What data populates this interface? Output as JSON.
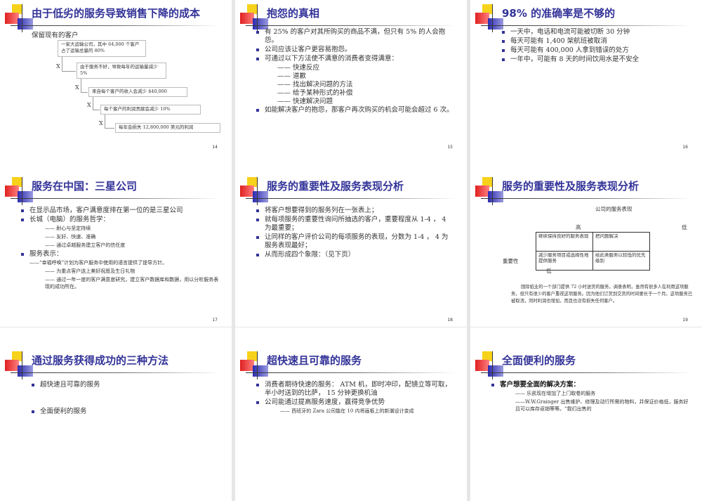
{
  "slides": [
    {
      "number": "14",
      "title": "由于低劣的服务导致销售下降的成本",
      "diagram": {
        "subtitle": "保留现有的客户",
        "mult": "X",
        "boxes": [
          "一家大运输公司，其中 64,000 个客户占了运输总量的 80%",
          "由于服务不好，导致每年的运输量减少 5%",
          "来自每个客户的收入会减少 $40,000",
          "每个客户的利润贡献会减少 10%",
          "每年会损失 12,800,000 美元的利润"
        ]
      }
    },
    {
      "number": "15",
      "title": "抱怨的真相",
      "items": [
        {
          "t": "b",
          "text": "有 25% 的客户对其所购买的商品不满，但只有 5% 的人会抱怨。"
        },
        {
          "t": "b",
          "text": "公司应该让客户更容易抱怨。"
        },
        {
          "t": "b",
          "text": "可通过以下方法使不满意的消费者变得满意："
        },
        {
          "t": "s",
          "text": "——  快速反应"
        },
        {
          "t": "s",
          "text": "——  道歉"
        },
        {
          "t": "s",
          "text": "——  找出解决问题的方法"
        },
        {
          "t": "s",
          "text": "——  给予某种形式的补偿"
        },
        {
          "t": "s",
          "text": "——  快速解决问题"
        },
        {
          "t": "b",
          "text": "如能解决客户的抱怨，那客户再次购买的机会可能会超过 6 次。"
        }
      ]
    },
    {
      "number": "16",
      "title": "98% 的准确率是不够的",
      "items": [
        {
          "t": "b",
          "text": "一天中，电话和电流可能被切断 30 分钟"
        },
        {
          "t": "b",
          "text": "每天可能有 1,400 架航班被取消"
        },
        {
          "t": "b",
          "text": "每天可能有 400,000 人拿到错误的处方"
        },
        {
          "t": "b",
          "text": "一年中，可能有 8 天的时间饮用水是不安全"
        }
      ]
    },
    {
      "number": "17",
      "title": "服务在中国：三星公司",
      "items": [
        {
          "t": "b",
          "text": "在显示品市场，客户满意度排在第一位的是三星公司"
        },
        {
          "t": "b",
          "text": "长城（电脑）的服务哲学："
        },
        {
          "t": "s2",
          "text": "—— 耐心与坚定持续"
        },
        {
          "t": "s2",
          "text": "—— 友好、快速、准确"
        },
        {
          "t": "s2",
          "text": "—— 通过卓越服务建立客户的信任度"
        },
        {
          "t": "b",
          "text": "服务表示："
        },
        {
          "t": "s3",
          "text": "——“幸福呼唤”计划为客户服务中使用的语言提供了提导方针。"
        },
        {
          "t": "s2",
          "text": "—— 为重点客户送上美好祝愿及生日礼物"
        },
        {
          "t": "s2",
          "text": "—— 通过一年一度的客户满意度研究，建立客户数据库和数据，用以分析服务表现的成功所在。"
        }
      ]
    },
    {
      "number": "18",
      "title": "服务的重要性及服务表现分析",
      "items": [
        {
          "t": "b",
          "text": "将客户想要得到的服务列在一张表上；"
        },
        {
          "t": "b",
          "text": "就每项服务的重要性询问所抽选的客户，重要程度从 1-4 ， 4 为最重要；"
        },
        {
          "t": "b",
          "text": "让同样的客户评价公司的每项服务的表现，分数为 1-4 ， 4 为服务表现最好；"
        },
        {
          "t": "b",
          "text": "从而形成四个象限：（见下页）"
        }
      ]
    },
    {
      "number": "19",
      "title": "服务的重要性及服务表现分析",
      "matrix": {
        "header": "公司的服务表现",
        "high": "高",
        "low_right": "低",
        "axis": "重要性",
        "low_bottom": "低",
        "cells": [
          [
            "继续保持良好的服务表现",
            "把问题解决"
          ],
          [
            "减少服务项目或选择性地提供服务",
            "给此类服务以较低的优先级别"
          ]
        ],
        "note": "国际纸业的一个部门提供 72 小时送货的服务，调查表明，虽然有很多人在利用这项服务，但只有很少的客户重视这项服务。因为他们订货到交货的时间要长于一个月。这项服务已被取消，同时利润也增加，而且也没有损失任何客户。"
      }
    },
    {
      "number": "",
      "title": "通过服务获得成功的三种方法",
      "items": [
        {
          "t": "b",
          "text": "超快速且可靠的服务"
        },
        {
          "t": "gap",
          "text": ""
        },
        {
          "t": "b",
          "text": "全面便利的服务"
        }
      ]
    },
    {
      "number": "",
      "title": "超快速且可靠的服务",
      "items": [
        {
          "t": "b",
          "text": "消费者期待快速的服务： ATM 机，即时冲印，配镜立等可取，半小时送到的比萨， 15 分钟更换机油"
        },
        {
          "t": "b",
          "text": "公司能通过提高服务速度，赢得竞争优势"
        },
        {
          "t": "s2",
          "text": "—— 西班牙的 Zara 公司能在 10 内将画板上的新潮设计变成"
        }
      ]
    },
    {
      "number": "",
      "title": "全面便利的服务",
      "items": [
        {
          "t": "bb",
          "text": "客户想要全面的解决方案："
        },
        {
          "t": "s2",
          "text": "—— 乐凯现在增加了上门取卷的服务"
        },
        {
          "t": "s2",
          "text": "——W.W.Grainger 出售维护、修理及动行所需的物料，并保证价格低，服务好且可以库存返销等等。“我们出售的"
        }
      ]
    }
  ]
}
